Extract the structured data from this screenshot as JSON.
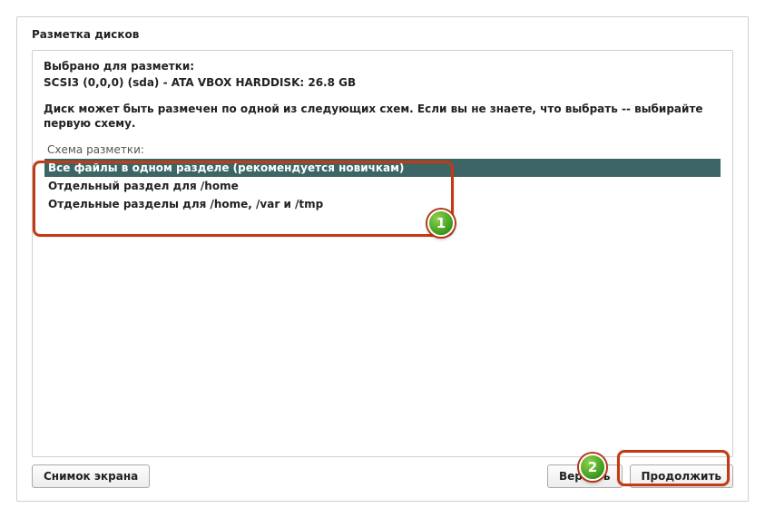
{
  "window_title": "Разметка дисков",
  "selected_label": "Выбрано для разметки:",
  "disk_line": "SCSI3 (0,0,0) (sda) - ATA VBOX HARDDISK: 26.8 GB",
  "hint_text": "Диск может быть размечен по одной из следующих схем. Если вы не знаете, что выбрать -- выбирайте первую схему.",
  "scheme_caption": "Схема разметки:",
  "schemes": {
    "opt0": "Все файлы в одном разделе (рекомендуется новичкам)",
    "opt1": "Отдельный раздел для /home",
    "opt2": "Отдельные разделы для /home, /var и /tmp"
  },
  "buttons": {
    "screenshot": "Снимок экрана",
    "back": "Вернуть",
    "continue": "Продолжить"
  },
  "annotations": {
    "n1": "1",
    "n2": "2"
  }
}
